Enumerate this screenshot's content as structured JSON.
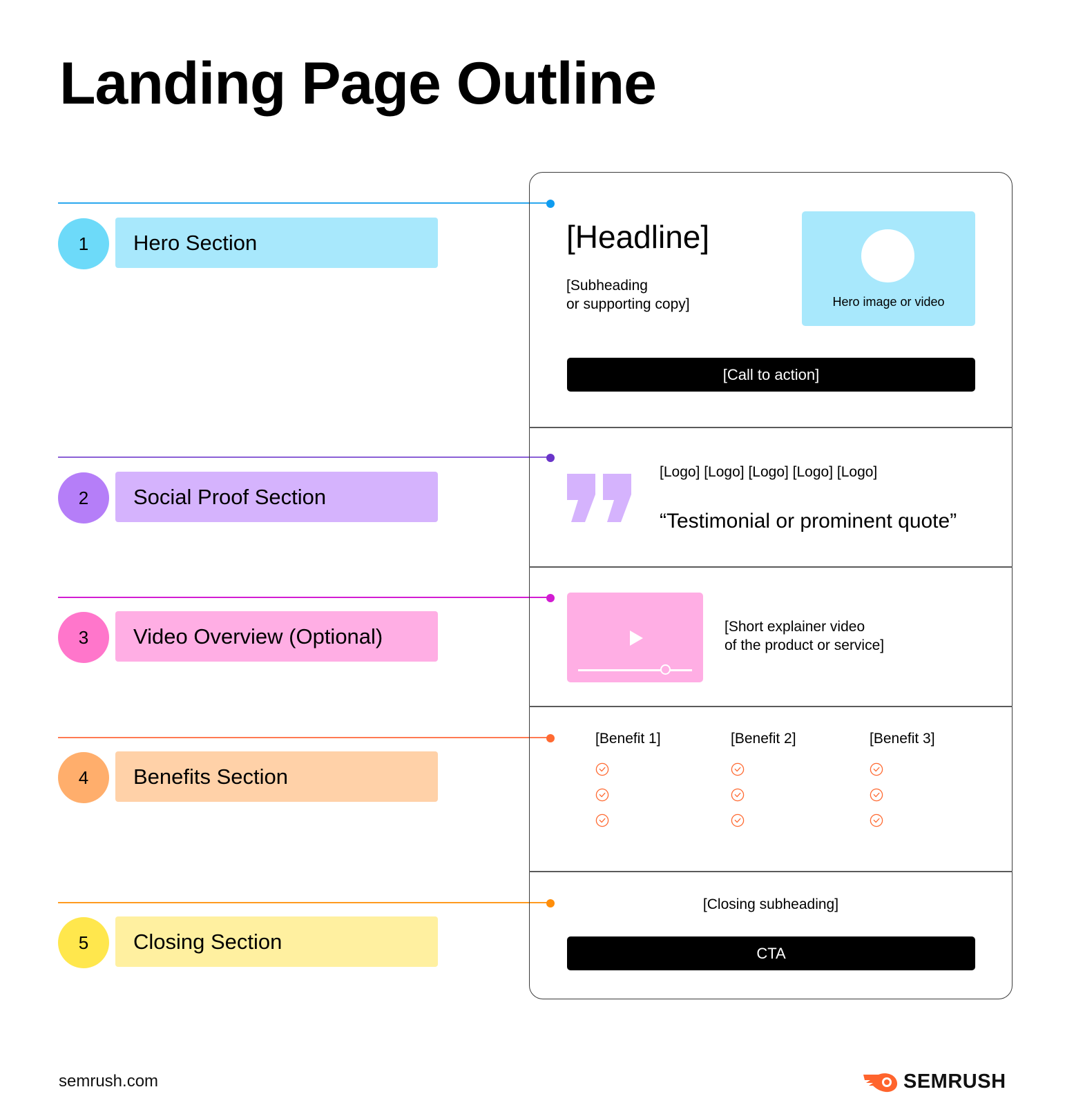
{
  "title": "Landing Page Outline",
  "sections": [
    {
      "number": "1",
      "label": "Hero Section",
      "line_color": "#2aa7ee",
      "dot_color": "#0f9cf0",
      "circle_color": "#6ddaf9",
      "label_bg": "#a8e8fc"
    },
    {
      "number": "2",
      "label": "Social Proof Section",
      "line_color": "#8a5fd6",
      "dot_color": "#6a35c9",
      "circle_color": "#b57ef8",
      "label_bg": "#d5b3fd"
    },
    {
      "number": "3",
      "label": "Video Overview (Optional)",
      "line_color": "#d21cd2",
      "dot_color": "#d21cd2",
      "circle_color": "#ff76cb",
      "label_bg": "#ffaee4"
    },
    {
      "number": "4",
      "label": "Benefits Section",
      "line_color": "#ff7a52",
      "dot_color": "#ff6a32",
      "circle_color": "#ffae6c",
      "label_bg": "#ffd1a8"
    },
    {
      "number": "5",
      "label": "Closing Section",
      "line_color": "#ff9a1f",
      "dot_color": "#ff8e0a",
      "circle_color": "#ffe74d",
      "label_bg": "#fff0a0"
    }
  ],
  "wireframe": {
    "hero": {
      "headline": "[Headline]",
      "subheading_line1": "[Subheading",
      "subheading_line2": "or supporting copy]",
      "media_caption": "Hero image or video",
      "cta": "[Call to action]"
    },
    "social_proof": {
      "logos": "[Logo] [Logo] [Logo] [Logo] [Logo]",
      "quote": "“Testimonial or prominent quote”",
      "quote_mark_color": "#d5b3fd"
    },
    "video": {
      "desc_line1": "[Short explainer video",
      "desc_line2": "of the product or service]"
    },
    "benefits": {
      "columns": [
        {
          "title": "[Benefit 1]",
          "checks": 3
        },
        {
          "title": "[Benefit 2]",
          "checks": 3
        },
        {
          "title": "[Benefit 3]",
          "checks": 3
        }
      ],
      "check_color": "#ff6a32"
    },
    "closing": {
      "subheading": "[Closing subheading]",
      "cta": "CTA"
    }
  },
  "footer": {
    "url": "semrush.com",
    "brand": "SEMRUSH",
    "brand_color": "#ff642d"
  }
}
